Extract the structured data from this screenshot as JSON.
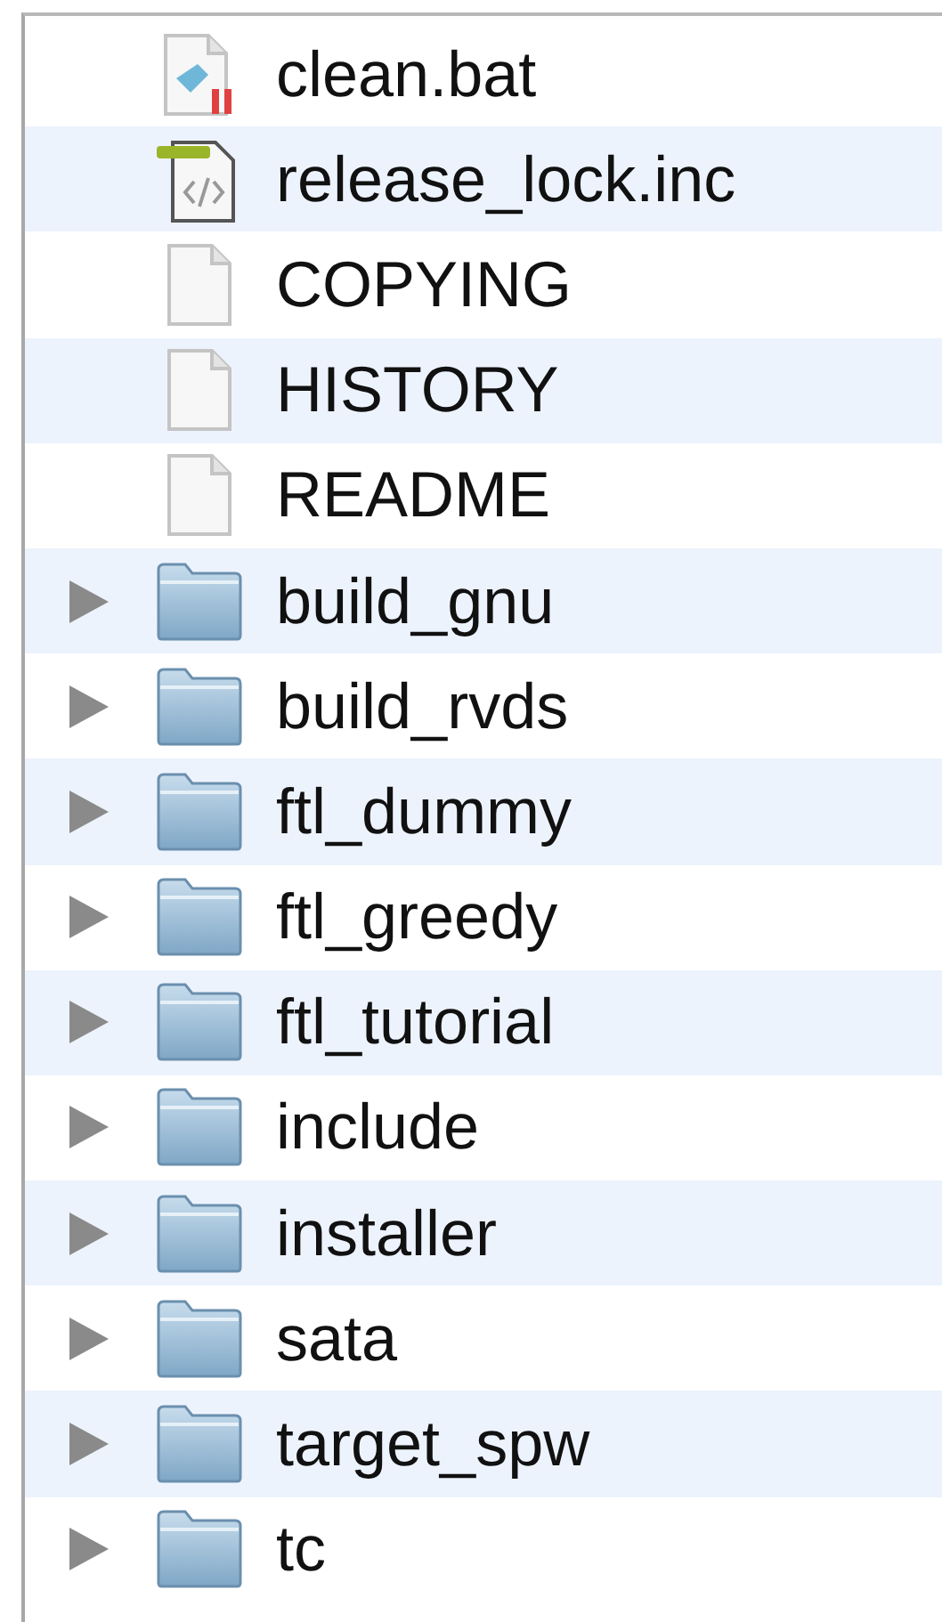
{
  "items": [
    {
      "name": "clean.bat",
      "kind": "script"
    },
    {
      "name": "release_lock.inc",
      "kind": "source"
    },
    {
      "name": "COPYING",
      "kind": "document"
    },
    {
      "name": "HISTORY",
      "kind": "document"
    },
    {
      "name": "README",
      "kind": "document"
    },
    {
      "name": "build_gnu",
      "kind": "folder",
      "expanded": false
    },
    {
      "name": "build_rvds",
      "kind": "folder",
      "expanded": false
    },
    {
      "name": "ftl_dummy",
      "kind": "folder",
      "expanded": false
    },
    {
      "name": "ftl_greedy",
      "kind": "folder",
      "expanded": false
    },
    {
      "name": "ftl_tutorial",
      "kind": "folder",
      "expanded": false
    },
    {
      "name": "include",
      "kind": "folder",
      "expanded": false
    },
    {
      "name": "installer",
      "kind": "folder",
      "expanded": false
    },
    {
      "name": "sata",
      "kind": "folder",
      "expanded": false
    },
    {
      "name": "target_spw",
      "kind": "folder",
      "expanded": false
    },
    {
      "name": "tc",
      "kind": "folder",
      "expanded": false
    }
  ]
}
